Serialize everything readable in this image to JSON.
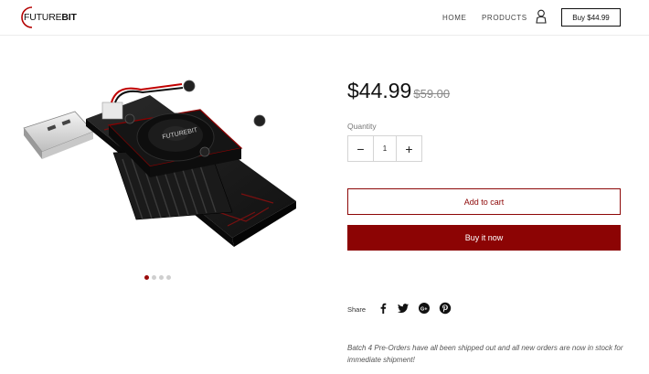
{
  "header": {
    "logo": {
      "text_a": "FUTURE",
      "text_b": "BIT"
    },
    "nav": [
      {
        "label": "HOME"
      },
      {
        "label": "PRODUCTS"
      }
    ],
    "account_icon": "user-outline-icon",
    "buy_button": "Buy $44.99"
  },
  "product": {
    "image_alt_logo": "FUTUREBIT",
    "gallery": {
      "count": 4,
      "active_index": 0
    },
    "price": "$44.99",
    "compare_price": "$59.00",
    "quantity_label": "Quantity",
    "quantity_value": "1",
    "minus_symbol": "−",
    "plus_symbol": "+",
    "add_to_cart": "Add to cart",
    "buy_now": "Buy it now",
    "share_label": "Share",
    "share_icons": [
      "facebook-icon",
      "twitter-icon",
      "google-plus-icon",
      "pinterest-icon"
    ],
    "description": "Batch 4 Pre-Orders have all been shipped out and all new orders are now in stock for immediate shipment!"
  },
  "colors": {
    "brand_red": "#8c0404",
    "text_dark": "#111111"
  }
}
